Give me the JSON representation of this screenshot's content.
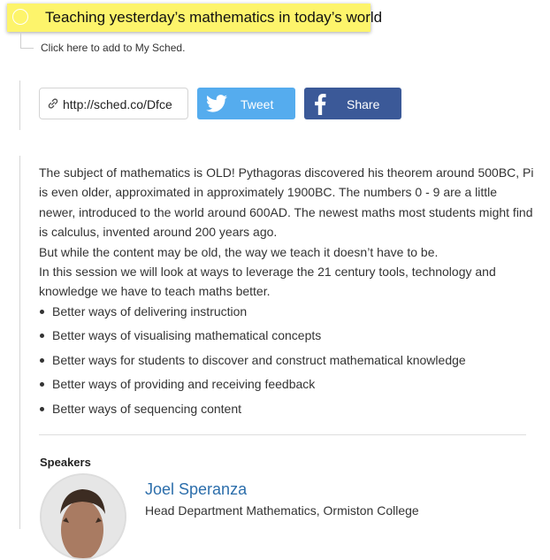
{
  "session": {
    "title": "Teaching yesterday’s mathematics in today’s world",
    "add_to_sched": "Click here to add to My Sched."
  },
  "share": {
    "url": "http://sched.co/Dfce",
    "tweet_label": "Tweet",
    "share_label": "Share",
    "icons": [
      "link-icon",
      "twitter-icon",
      "facebook-icon"
    ]
  },
  "description": {
    "paragraphs": [
      "The subject of mathematics is OLD! Pythagoras discovered his theorem around 500BC, Pi is even older, approximated in approximately 1900BC. The numbers 0 - 9 are a little newer, introduced to the world around 600AD. The newest maths most students might find is calculus, invented around 200 years ago.",
      "But while the content may be old, the way we teach it doesn’t have to be.",
      "In this session we will look at ways to leverage the 21 century tools, technology and knowledge we have to teach maths better."
    ],
    "bullets": [
      "Better ways of delivering instruction",
      "Better ways of visualising mathematical concepts",
      "Better ways for students to discover and construct mathematical knowledge",
      "Better ways of providing and receiving feedback",
      "Better ways of sequencing content"
    ]
  },
  "speakers": {
    "heading": "Speakers",
    "list": [
      {
        "name": "Joel Speranza",
        "role": "Head Department Mathematics, Ormiston College"
      }
    ]
  },
  "colors": {
    "title_highlight": "#fdf46b",
    "twitter": "#55acee",
    "facebook": "#3b5998",
    "link": "#2c6eab"
  }
}
